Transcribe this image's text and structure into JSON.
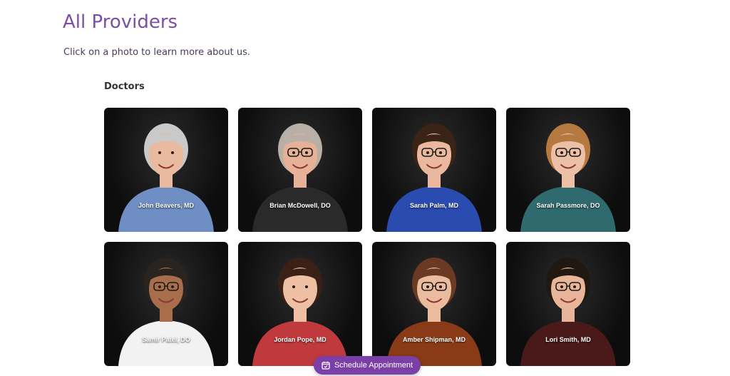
{
  "header": {
    "title": "All Providers",
    "subtitle": "Click on a photo to learn more about us."
  },
  "section": {
    "heading": "Doctors"
  },
  "providers": [
    {
      "name": "John Beavers, MD",
      "skin": "#e9b9a0",
      "hair": "#c9c9c9",
      "shirt": "#6f8fc4",
      "glasses": false
    },
    {
      "name": "Brian McDowell, DO",
      "skin": "#e6b196",
      "hair": "#b8b0a6",
      "shirt": "#2a2a2a",
      "glasses": true
    },
    {
      "name": "Sarah Palm, MD",
      "skin": "#eab89e",
      "hair": "#3a2418",
      "shirt": "#2a4bb0",
      "glasses": true
    },
    {
      "name": "Sarah Passmore, DO",
      "skin": "#ecc0a6",
      "hair": "#b5793f",
      "shirt": "#2f6a6e",
      "glasses": true
    },
    {
      "name": "Samir Patel, DO",
      "skin": "#a86e4c",
      "hair": "#2a2420",
      "shirt": "#f2f2f2",
      "glasses": true
    },
    {
      "name": "Jordan Pope, MD",
      "skin": "#edbfa3",
      "hair": "#3a2016",
      "shirt": "#c0393c",
      "glasses": false
    },
    {
      "name": "Amber Shipman, MD",
      "skin": "#ebbb9f",
      "hair": "#6a3a22",
      "shirt": "#8a3a16",
      "glasses": true
    },
    {
      "name": "Lori Smith, MD",
      "skin": "#e8b59a",
      "hair": "#221812",
      "shirt": "#4a1a1a",
      "glasses": true
    }
  ],
  "cta": {
    "label": "Schedule Appointment"
  }
}
